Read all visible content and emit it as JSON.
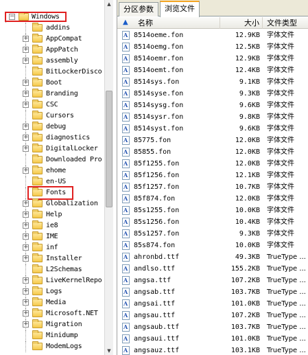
{
  "tree": {
    "items": [
      {
        "label": "Windows",
        "indent": 1,
        "expander": "minus",
        "highlight": true
      },
      {
        "label": "addins",
        "indent": 2,
        "expander": ""
      },
      {
        "label": "AppCompat",
        "indent": 2,
        "expander": "plus"
      },
      {
        "label": "AppPatch",
        "indent": 2,
        "expander": "plus"
      },
      {
        "label": "assembly",
        "indent": 2,
        "expander": "plus"
      },
      {
        "label": "BitLockerDisco",
        "indent": 2,
        "expander": ""
      },
      {
        "label": "Boot",
        "indent": 2,
        "expander": "plus"
      },
      {
        "label": "Branding",
        "indent": 2,
        "expander": "plus"
      },
      {
        "label": "CSC",
        "indent": 2,
        "expander": "plus"
      },
      {
        "label": "Cursors",
        "indent": 2,
        "expander": ""
      },
      {
        "label": "debug",
        "indent": 2,
        "expander": "plus"
      },
      {
        "label": "diagnostics",
        "indent": 2,
        "expander": "plus"
      },
      {
        "label": "DigitalLocker",
        "indent": 2,
        "expander": "plus"
      },
      {
        "label": "Downloaded Pro",
        "indent": 2,
        "expander": ""
      },
      {
        "label": "ehome",
        "indent": 2,
        "expander": "plus"
      },
      {
        "label": "en-US",
        "indent": 2,
        "expander": ""
      },
      {
        "label": "Fonts",
        "indent": 2,
        "expander": "",
        "highlight": true
      },
      {
        "label": "Globalization",
        "indent": 2,
        "expander": "plus"
      },
      {
        "label": "Help",
        "indent": 2,
        "expander": "plus"
      },
      {
        "label": "ie8",
        "indent": 2,
        "expander": "plus"
      },
      {
        "label": "IME",
        "indent": 2,
        "expander": "plus"
      },
      {
        "label": "inf",
        "indent": 2,
        "expander": "plus"
      },
      {
        "label": "Installer",
        "indent": 2,
        "expander": "plus"
      },
      {
        "label": "L2Schemas",
        "indent": 2,
        "expander": ""
      },
      {
        "label": "LiveKernelRepo",
        "indent": 2,
        "expander": "plus"
      },
      {
        "label": "Logs",
        "indent": 2,
        "expander": "plus"
      },
      {
        "label": "Media",
        "indent": 2,
        "expander": "plus"
      },
      {
        "label": "Microsoft.NET",
        "indent": 2,
        "expander": "plus"
      },
      {
        "label": "Migration",
        "indent": 2,
        "expander": "plus"
      },
      {
        "label": "Minidump",
        "indent": 2,
        "expander": ""
      },
      {
        "label": "ModemLogs",
        "indent": 2,
        "expander": ""
      }
    ]
  },
  "scrollbar": {
    "up_arrow": "▲",
    "down_arrow": "▼"
  },
  "right": {
    "tabs": [
      {
        "label": "分区参数"
      },
      {
        "label": "浏览文件"
      }
    ],
    "active_tab": 1,
    "columns": {
      "name": "名称",
      "size": "大小",
      "type": "文件类型"
    },
    "sort_icon": "▲",
    "files": [
      {
        "name": "8514oeme.fon",
        "size": "12.9KB",
        "type": "字体文件"
      },
      {
        "name": "8514oemg.fon",
        "size": "12.5KB",
        "type": "字体文件"
      },
      {
        "name": "8514oemr.fon",
        "size": "12.9KB",
        "type": "字体文件"
      },
      {
        "name": "8514oemt.fon",
        "size": "12.4KB",
        "type": "字体文件"
      },
      {
        "name": "8514sys.fon",
        "size": "9.1KB",
        "type": "字体文件"
      },
      {
        "name": "8514syse.fon",
        "size": "9.3KB",
        "type": "字体文件"
      },
      {
        "name": "8514sysg.fon",
        "size": "9.6KB",
        "type": "字体文件"
      },
      {
        "name": "8514sysr.fon",
        "size": "9.8KB",
        "type": "字体文件"
      },
      {
        "name": "8514syst.fon",
        "size": "9.6KB",
        "type": "字体文件"
      },
      {
        "name": "85775.fon",
        "size": "12.0KB",
        "type": "字体文件"
      },
      {
        "name": "85855.fon",
        "size": "12.0KB",
        "type": "字体文件"
      },
      {
        "name": "85f1255.fon",
        "size": "12.0KB",
        "type": "字体文件"
      },
      {
        "name": "85f1256.fon",
        "size": "12.1KB",
        "type": "字体文件"
      },
      {
        "name": "85f1257.fon",
        "size": "10.7KB",
        "type": "字体文件"
      },
      {
        "name": "85f874.fon",
        "size": "12.0KB",
        "type": "字体文件"
      },
      {
        "name": "85s1255.fon",
        "size": "10.0KB",
        "type": "字体文件"
      },
      {
        "name": "85s1256.fon",
        "size": "10.4KB",
        "type": "字体文件"
      },
      {
        "name": "85s1257.fon",
        "size": "9.3KB",
        "type": "字体文件"
      },
      {
        "name": "85s874.fon",
        "size": "10.0KB",
        "type": "字体文件"
      },
      {
        "name": "ahronbd.ttf",
        "size": "49.3KB",
        "type": "TrueType ..."
      },
      {
        "name": "andlso.ttf",
        "size": "155.2KB",
        "type": "TrueType ..."
      },
      {
        "name": "angsa.ttf",
        "size": "107.2KB",
        "type": "TrueType ..."
      },
      {
        "name": "angsab.ttf",
        "size": "103.7KB",
        "type": "TrueType ..."
      },
      {
        "name": "angsai.ttf",
        "size": "101.0KB",
        "type": "TrueType ..."
      },
      {
        "name": "angsau.ttf",
        "size": "107.2KB",
        "type": "TrueType ..."
      },
      {
        "name": "angsaub.ttf",
        "size": "103.7KB",
        "type": "TrueType ..."
      },
      {
        "name": "angsaui.ttf",
        "size": "101.0KB",
        "type": "TrueType ..."
      },
      {
        "name": "angsauz.ttf",
        "size": "103.1KB",
        "type": "TrueType ..."
      }
    ]
  },
  "colors": {
    "highlight": "#e02020",
    "folder": "#f5c94a",
    "tab_accent": "#f5a623"
  }
}
